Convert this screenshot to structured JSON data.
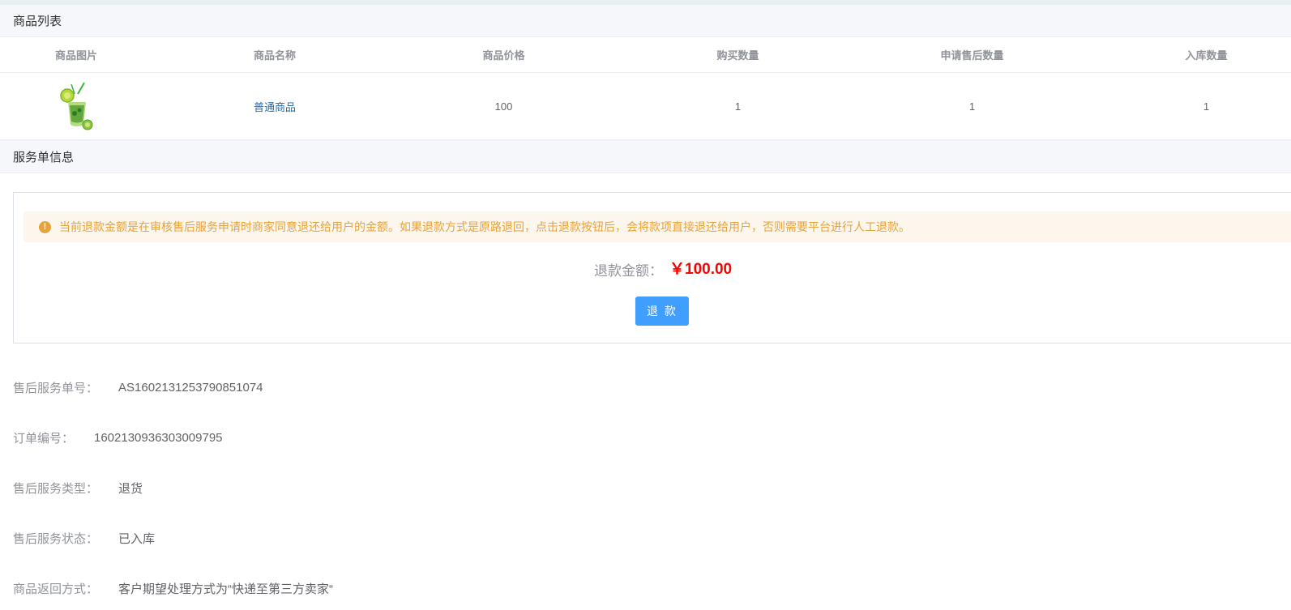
{
  "goods_section": {
    "title": "商品列表"
  },
  "table": {
    "headers": [
      "商品图片",
      "商品名称",
      "商品价格",
      "购买数量",
      "申请售后数量",
      "入库数量"
    ],
    "rows": [
      {
        "image": "cocktail-drink-image",
        "name": "普通商品",
        "price": "100",
        "buy_qty": "1",
        "apply_qty": "1",
        "stock_qty": "1"
      }
    ]
  },
  "service_section": {
    "title": "服务单信息"
  },
  "refund": {
    "notice": "当前退款金额是在审核售后服务申请时商家同意退还给用户的金额。如果退款方式是原路退回，点击退款按钮后，会将款项直接退还给用户，否则需要平台进行人工退款。",
    "notice_icon": "warning-icon",
    "amount_label": "退款金额：",
    "amount_value": "￥100.00",
    "button_label": "退 款",
    "colors": {
      "warning": "#e6a23c",
      "warning_bg": "#fdf6ec",
      "primary": "#409eff",
      "amount": "#ff0000"
    }
  },
  "info": {
    "service_no_label": "售后服务单号：",
    "service_no": "AS1602131253790851074",
    "order_no_label": "订单编号：",
    "order_no": "1602130936303009795",
    "service_type_label": "售后服务类型：",
    "service_type": "退货",
    "service_status_label": "售后服务状态：",
    "service_status": "已入库",
    "return_method_label": "商品返回方式：",
    "return_method": "客户期望处理方式为“快递至第三方卖家“"
  }
}
